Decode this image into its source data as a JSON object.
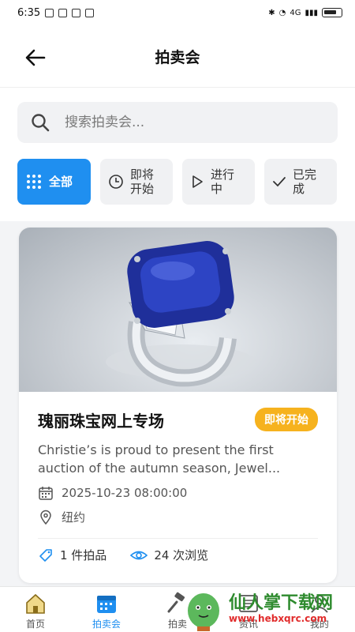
{
  "status_bar": {
    "time": "6:35",
    "network": "4G"
  },
  "header": {
    "title": "拍卖会"
  },
  "search": {
    "placeholder": "搜索拍卖会..."
  },
  "filters": [
    {
      "label": "全部",
      "icon": "grid-icon",
      "active": true
    },
    {
      "label": "即将开始",
      "icon": "clock-icon",
      "active": false
    },
    {
      "label": "进行中",
      "icon": "play-icon",
      "active": false
    },
    {
      "label": "已完成",
      "icon": "check-icon",
      "active": false
    }
  ],
  "card": {
    "title": "瑰丽珠宝网上专场",
    "status": "即将开始",
    "description": "Christie’s is proud to present the first auction of the autumn season, Jewel...",
    "date": "2025-10-23 08:00:00",
    "location": "纽约",
    "lots": "1 件拍品",
    "views": "24 次浏览"
  },
  "bottom_nav": [
    {
      "label": "首页",
      "icon": "home-icon",
      "active": false
    },
    {
      "label": "拍卖会",
      "icon": "calendar-icon",
      "active": true
    },
    {
      "label": "拍卖",
      "icon": "gavel-icon",
      "active": false
    },
    {
      "label": "资讯",
      "icon": "news-icon",
      "active": false
    },
    {
      "label": "我的",
      "icon": "user-icon",
      "active": false
    }
  ],
  "watermark": {
    "text": "仙人掌下载网",
    "url": "www.hebxqrc.com"
  },
  "colors": {
    "accent": "#1f8ff0",
    "badge": "#f6b21e"
  }
}
